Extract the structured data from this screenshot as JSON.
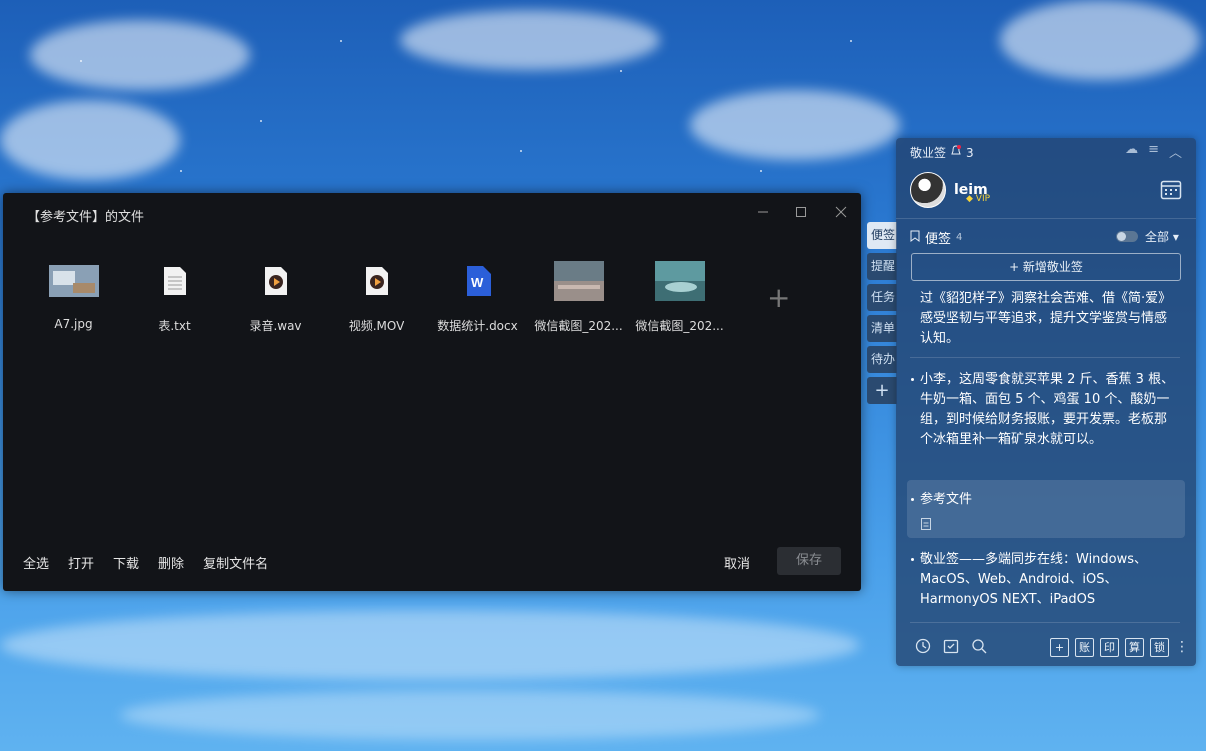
{
  "dialog": {
    "title": "【参考文件】的文件",
    "files": [
      {
        "name": "A7.jpg",
        "icon": "image-thumbnail"
      },
      {
        "name": "表.txt",
        "icon": "text-file-icon"
      },
      {
        "name": "录音.wav",
        "icon": "audio-file-icon"
      },
      {
        "name": "视频.MOV",
        "icon": "video-file-icon"
      },
      {
        "name": "数据统计.docx",
        "icon": "word-file-icon"
      },
      {
        "name": "微信截图_202...",
        "icon": "image-thumbnail"
      },
      {
        "name": "微信截图_202...",
        "icon": "image-thumbnail"
      }
    ],
    "add_label": "+",
    "actions": [
      "全选",
      "打开",
      "下载",
      "删除",
      "复制文件名"
    ],
    "cancel": "取消",
    "save": "保存"
  },
  "side_tabs": [
    "便签",
    "提醒",
    "任务",
    "清单",
    "待办",
    "+"
  ],
  "panel": {
    "app_name": "敬业签",
    "notify_count": "3",
    "user_name": "leim",
    "vip": "VIP",
    "notes_label": "便签",
    "notes_count": "4",
    "filter": "全部",
    "new_note": "+ 新增敬业签",
    "notes": [
      "过《貂犯样子》洞察社会苦难、借《简·爱》感受坚韧与平等追求，提升文学鉴赏与情感认知。",
      "小李，这周零食就买苹果 2 斤、香蕉 3 根、牛奶一箱、面包 5 个、鸡蛋 10 个、酸奶一组，到时候给财务报账，要开发票。老板那个冰箱里补一箱矿泉水就可以。",
      "参考文件",
      "敬业签——多端同步在线：Windows、MacOS、Web、Android、iOS、HarmonyOS NEXT、iPadOS"
    ],
    "bottom_boxes": [
      "+",
      "账",
      "印",
      "算",
      "锁"
    ]
  },
  "colors": {
    "accent": "#2b5fd9",
    "panel_bg": "#22426e",
    "vip": "#f5d33a"
  }
}
